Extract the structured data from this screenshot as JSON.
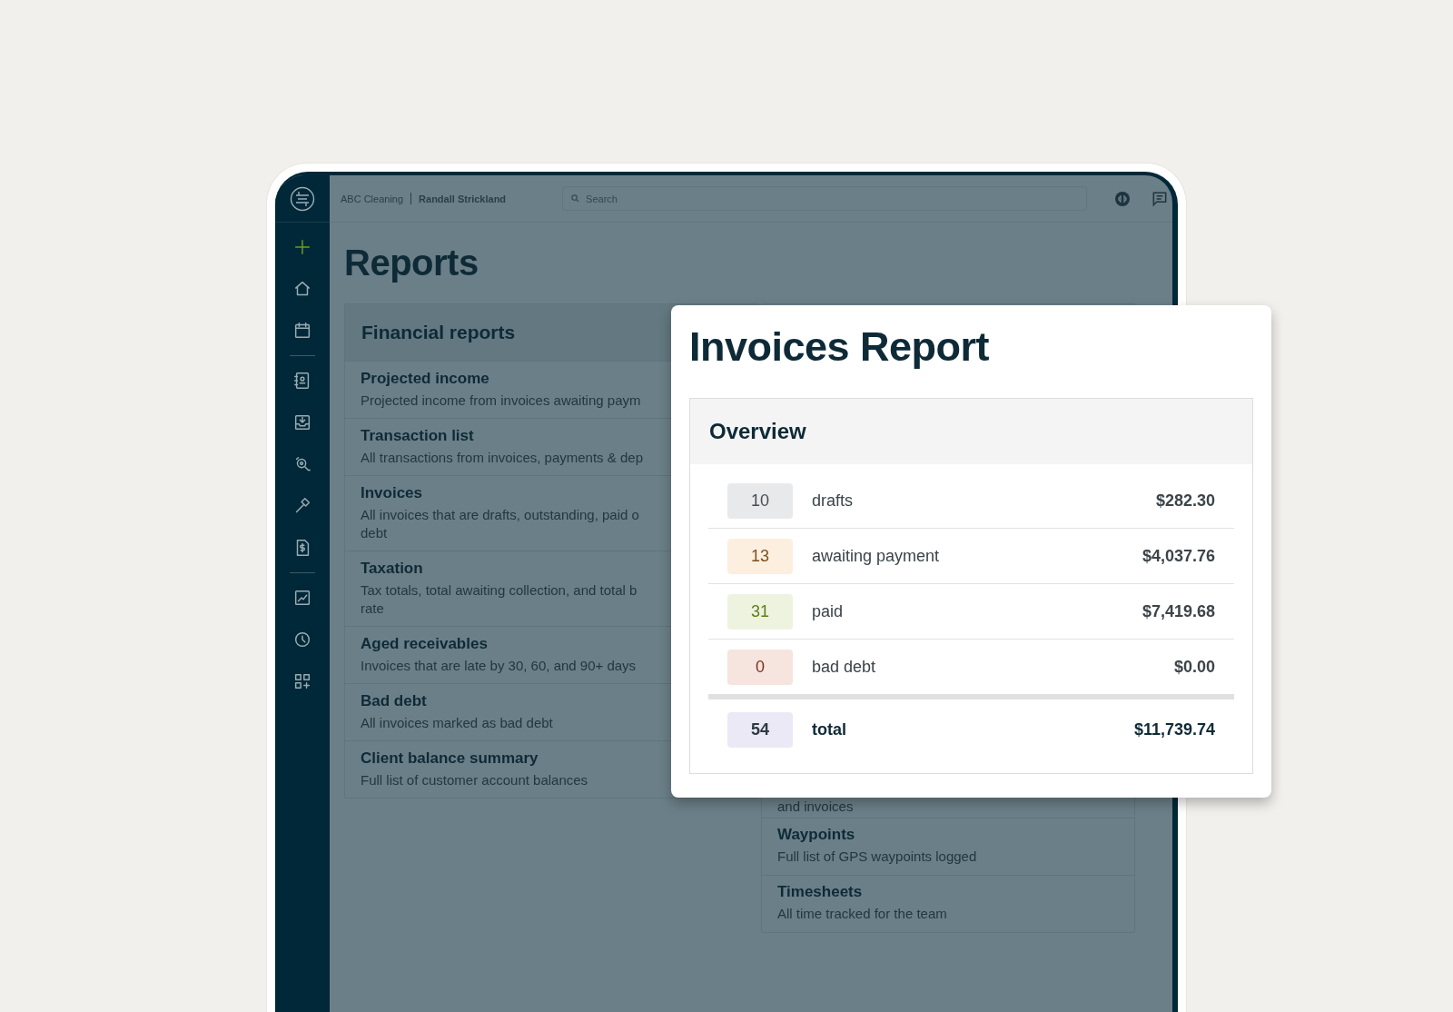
{
  "top_bar": {
    "company": "ABC Cleaning",
    "user": "Randall Strickland",
    "search": {
      "placeholder": "Search"
    }
  },
  "page": {
    "title": "Reports"
  },
  "financial_reports": {
    "title": "Financial reports",
    "items": [
      {
        "title": "Projected income",
        "description": "Projected income from invoices awaiting paym"
      },
      {
        "title": "Transaction list",
        "description": "All transactions from invoices, payments & dep"
      },
      {
        "title": "Invoices",
        "description": "All invoices that are drafts, outstanding, paid o\ndebt"
      },
      {
        "title": "Taxation",
        "description": "Tax totals, total awaiting collection, and total b\nrate"
      },
      {
        "title": "Aged receivables",
        "description": "Invoices that are late by 30, 60, and 90+ days"
      },
      {
        "title": "Bad debt",
        "description": "All invoices marked as bad debt"
      },
      {
        "title": "Client balance summary",
        "description": "Full list of customer account balances"
      }
    ]
  },
  "other_reports": {
    "items": [
      {
        "description": "and invoices"
      },
      {
        "title": "Waypoints",
        "description": "Full list of GPS waypoints logged"
      },
      {
        "title": "Timesheets",
        "description": "All time tracked for the team"
      }
    ]
  },
  "invoices_report": {
    "title": "Invoices Report",
    "overview": {
      "title": "Overview",
      "rows": [
        {
          "kind": "status",
          "count": "10",
          "label": "drafts",
          "amount": "$282.30",
          "color": "#e8e9ea"
        },
        {
          "kind": "status",
          "count": "13",
          "label": "awaiting payment",
          "amount": "$4,037.76",
          "color": "#fcefe0"
        },
        {
          "kind": "status",
          "count": "31",
          "label": "paid",
          "amount": "$7,419.68",
          "color": "#edf3df"
        },
        {
          "kind": "status",
          "count": "0",
          "label": "bad debt",
          "amount": "$0.00",
          "color": "#f6e4df"
        },
        {
          "kind": "total",
          "count": "54",
          "label": "total",
          "amount": "$11,739.74",
          "color": "#ebe9f6"
        }
      ]
    }
  }
}
